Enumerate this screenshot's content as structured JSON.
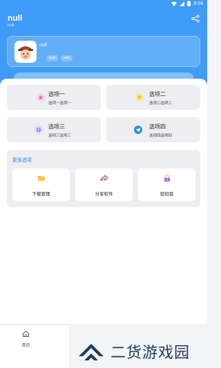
{
  "status": {
    "time": "9:34"
  },
  "header": {
    "title": "null",
    "subtitle": "null",
    "share_icon": "share-icon"
  },
  "profile": {
    "name": "null",
    "tags": [
      "null",
      "null"
    ],
    "avatar_icon": "cartoon-face-avatar"
  },
  "options": [
    {
      "title": "选项一",
      "desc": "选项一选项一",
      "icon": "pink-circle-icon",
      "color": "#e766b6"
    },
    {
      "title": "选项二",
      "desc": "选项二选项二",
      "icon": "yellow-circle-icon",
      "color": "#f3c627"
    },
    {
      "title": "选项三",
      "desc": "选项三选项三",
      "icon": "purple-coin-icon",
      "color": "#a87ae6"
    },
    {
      "title": "选项四",
      "desc": "选项四选项四",
      "icon": "telegram-icon",
      "color": "#2f8fd8"
    }
  ],
  "more": {
    "title": "更多选项",
    "tools": [
      {
        "label": "下载管理",
        "icon": "folder-icon"
      },
      {
        "label": "分享软件",
        "icon": "share-arrow-icon"
      },
      {
        "label": "密码锁",
        "icon": "lock-icon"
      }
    ]
  },
  "tabbar": {
    "home_label": "首页"
  },
  "watermark": {
    "text": "二货游戏园"
  },
  "colors": {
    "primary": "#3f9bf6",
    "accent_text": "#2d7fe0",
    "card_bg": "#eceef1"
  }
}
